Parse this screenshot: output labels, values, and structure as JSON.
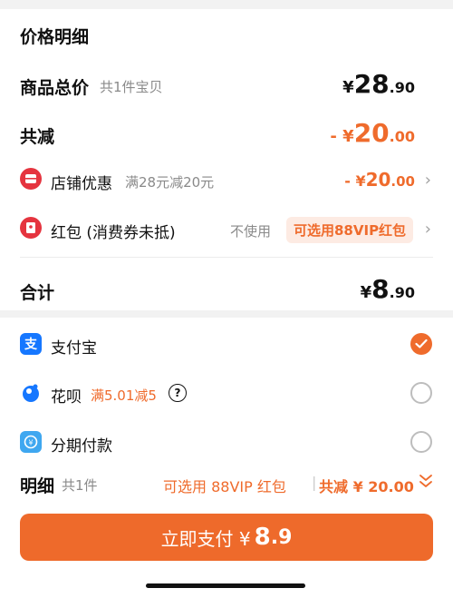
{
  "price_detail": {
    "title": "价格明细",
    "items_total": {
      "label": "商品总价",
      "sub": "共1件宝贝",
      "yen": "¥",
      "int": "28",
      "dec": ".90"
    },
    "reduction": {
      "label": "共减",
      "prefix": "- ¥",
      "int": "20",
      "dec": ".00"
    },
    "store_discount": {
      "label": "店铺优惠",
      "sub": "满28元减20元",
      "prefix": "- ¥",
      "int": "20",
      "dec": ".00"
    },
    "red_packet": {
      "label": "红包 (消费券未抵)",
      "status": "不使用",
      "badge": "可选用88VIP红包"
    },
    "total": {
      "label": "合计",
      "yen": "¥",
      "int": "8",
      "dec": ".90"
    }
  },
  "payment": {
    "methods": [
      {
        "label": "支付宝",
        "icon": "alipay-icon",
        "selected": true
      },
      {
        "label": "花呗",
        "promo": "满5.01减5",
        "icon": "huabei-icon",
        "selected": false
      },
      {
        "label": "分期付款",
        "icon": "installment-icon",
        "selected": false
      }
    ],
    "summary": {
      "label": "明细",
      "count": "共1件",
      "vip": "可选用 88VIP 红包",
      "separator": "|",
      "reduce": "共减 ¥ 20.00"
    }
  },
  "pay_button": {
    "label": "立即支付 ¥",
    "int": "8",
    "dec": ".9"
  },
  "colors": {
    "accent": "#ef6b2c",
    "red_icon": "#e5343f",
    "alipay_blue": "#1677ff"
  }
}
